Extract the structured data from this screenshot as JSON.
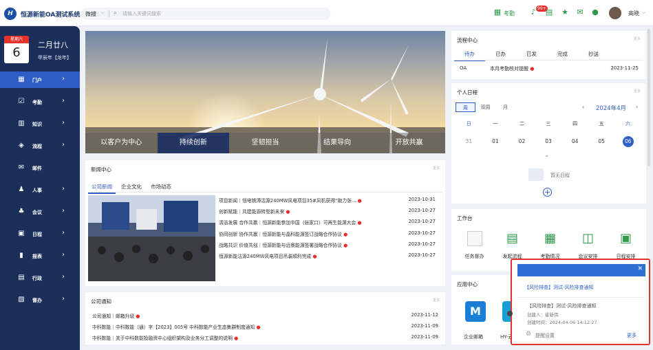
{
  "app": {
    "logo_letter": "H",
    "title": "恒源新能OA测试系统"
  },
  "search": {
    "scope": "微搜",
    "placeholder": "请输入关键词搜索"
  },
  "header": {
    "attendance_label": "考勤",
    "badge": "99+",
    "user_name": "高晓"
  },
  "date": {
    "weekday": "星期六",
    "day": "6",
    "lunar": "二月廿八",
    "year_label": "甲辰年【龙年】"
  },
  "nav": [
    {
      "label": "门户",
      "icon": "portal-icon"
    },
    {
      "label": "考勤",
      "icon": "calendar-check-icon"
    },
    {
      "label": "知识",
      "icon": "book-icon"
    },
    {
      "label": "流程",
      "icon": "flow-icon"
    },
    {
      "label": "邮件",
      "icon": "mail-icon"
    },
    {
      "label": "人事",
      "icon": "person-icon"
    },
    {
      "label": "会议",
      "icon": "meeting-icon"
    },
    {
      "label": "日程",
      "icon": "schedule-icon"
    },
    {
      "label": "报表",
      "icon": "chart-icon"
    },
    {
      "label": "行政",
      "icon": "admin-icon"
    },
    {
      "label": "督办",
      "icon": "supervise-icon"
    }
  ],
  "banner": {
    "tabs": [
      "以客户为中心",
      "持续创新",
      "坚韧担当",
      "结果导向",
      "开放共赢"
    ],
    "active_index": 1
  },
  "news": {
    "title": "新闻中心",
    "more": "更多",
    "tabs": [
      "公司新闻",
      "企业文化",
      "市场动态"
    ],
    "items": [
      {
        "title": "项目新闻｜恒电铁溥沽源240MW风电项目35#风机获得“助力张...",
        "date": "2023-10-31"
      },
      {
        "title": "创新赋能｜共建能源转型新未来",
        "date": "2023-10-27"
      },
      {
        "title": "清洁发展 合作共赢｜恒源新能参加中国（张家口）可再生能源大会",
        "date": "2023-10-27"
      },
      {
        "title": "协同创新 协作共赢｜恒源新能与晶科能源签订战略合作协议",
        "date": "2023-10-27"
      },
      {
        "title": "战略共识 价值共创｜恒源新能与远景能源签署战略合作协议",
        "date": "2023-10-27"
      },
      {
        "title": "恒源新能沽源240MW风电项目吊装顺利完成",
        "date": "2023-10-27"
      }
    ]
  },
  "notice": {
    "title": "公司通知",
    "more": "更多",
    "items": [
      {
        "title": "公司通知｜邮箱升级",
        "date": "2023-11-12"
      },
      {
        "title": "中科数能｜中科数能（通）字【2023】005号 中科数能产业生态集群制度通知",
        "date": "2023-11-09"
      },
      {
        "title": "中科数能｜关于中科数能投融资中心组织架构及业务分工调整的说明",
        "date": "2023-11-09"
      }
    ]
  },
  "flow": {
    "title": "流程中心",
    "more": "更多",
    "tabs": [
      "待办",
      "已办",
      "已发",
      "完成",
      "抄送"
    ],
    "rows": [
      {
        "type": "OA",
        "title": "本月考勤核对提醒",
        "date": "2023-11-25"
      }
    ]
  },
  "calendar": {
    "title": "个人日程",
    "more": "更多",
    "modes": [
      "周",
      "双周",
      "月"
    ],
    "month": "2024年4月",
    "weekdays": [
      "日",
      "一",
      "二",
      "三",
      "四",
      "五",
      "六"
    ],
    "days": [
      "31",
      "01",
      "02",
      "03",
      "04",
      "05",
      "06"
    ],
    "empty_text": "暂无日程"
  },
  "workbench": {
    "title": "工作台",
    "items": [
      "任务督办",
      "发起流程",
      "考勤情况",
      "会议安排",
      "日程安排"
    ]
  },
  "apps": {
    "title": "应用中心",
    "items": [
      "企业邮箱",
      "HY-云传"
    ]
  },
  "popup": {
    "link": "【风险排查】测试-风险排查通知",
    "title": "【风险排查】测试-风险排查通知",
    "creator": "创建人：崔新伟",
    "time": "创建时间：2024-04-06 14:12:27",
    "settings": "提醒设置",
    "more": "更多"
  },
  "colors": {
    "brand": "#1b2f5a",
    "accent": "#2f5ec7",
    "alert": "#e5322d",
    "green": "#2e9a4a"
  }
}
